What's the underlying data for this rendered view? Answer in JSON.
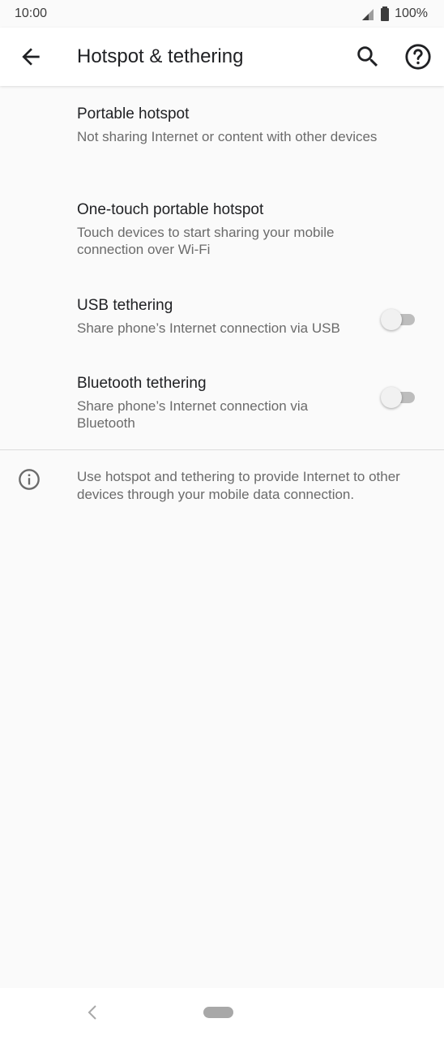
{
  "status_bar": {
    "time": "10:00",
    "battery": "100%"
  },
  "app_bar": {
    "title": "Hotspot & tethering",
    "back_icon": "arrow-back-icon",
    "search_icon": "search-icon",
    "help_icon": "help-icon"
  },
  "items": [
    {
      "title": "Portable hotspot",
      "subtitle": "Not sharing Internet or content with other devices"
    },
    {
      "title": "One-touch portable hotspot",
      "subtitle": "Touch devices to start sharing your mobile connection over Wi-Fi"
    },
    {
      "title": "USB tethering",
      "subtitle": "Share phone’s Internet connection via USB",
      "toggle": false
    },
    {
      "title": "Bluetooth tethering",
      "subtitle": "Share phone’s Internet connection via Bluetooth",
      "toggle": false
    }
  ],
  "info": {
    "text": "Use hotspot and tethering to provide Internet to other devices through your mobile data connection."
  },
  "colors": {
    "background": "#fafafa",
    "app_bar": "#ffffff",
    "toggle_off_track": "#bdbdbd"
  }
}
